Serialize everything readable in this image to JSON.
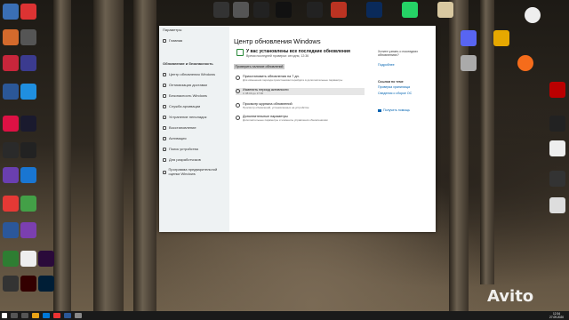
{
  "window": {
    "sidebar_title": "Параметры",
    "items": [
      "Главная",
      "Обновление и безопасность",
      "Центр обновления Windows",
      "Оптимизация доставки",
      "Безопасность Windows",
      "Служба архивации",
      "Устранение неполадок",
      "Восстановление",
      "Активация",
      "Поиск устройства",
      "Для разработчиков",
      "Программа предварительной оценки Windows"
    ]
  },
  "main": {
    "title": "Центр обновления Windows",
    "status_heading": "У вас установлены все последние обновления",
    "status_sub": "Время последней проверки: сегодня, 12:36",
    "check_button": "Проверить наличие обновлений",
    "options": [
      {
        "title": "Приостановить обновления на 7 дн.",
        "desc": "Для изменения периода приостановки перейдите в дополнительные параметры"
      },
      {
        "title": "Изменить период активности",
        "desc": "С 08:00 до 17:00"
      },
      {
        "title": "Просмотр журнала обновлений",
        "desc": "Просмотр обновлений, установленных на устройстве"
      },
      {
        "title": "Дополнительные параметры",
        "desc": "Дополнительные параметры и элементы управления обновлениями"
      }
    ],
    "right": {
      "info_text": "Хотите узнать о последних обновлениях?",
      "more_link": "Подробнее",
      "related_head": "Ссылки по теме",
      "link1": "Проверка хранилища",
      "link2": "Сведения о сборке ОС",
      "help_link": "Получить помощь"
    }
  },
  "taskbar": {
    "time": "12:34",
    "date": "27.09.2020"
  },
  "watermark": "Avito"
}
